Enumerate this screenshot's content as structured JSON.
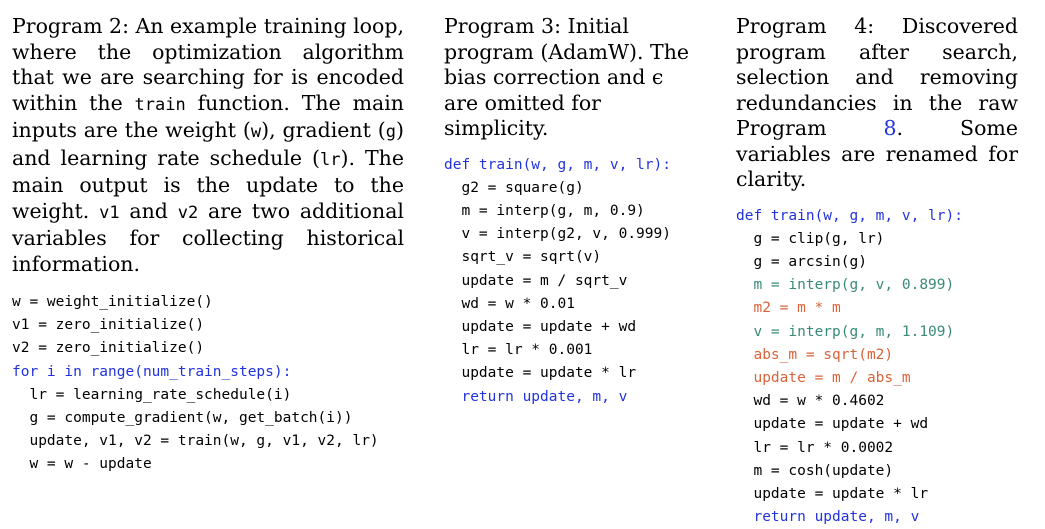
{
  "program2": {
    "caption": {
      "part1": "Program 2:",
      "part2": " An example training loop, where the optimization algorithm that we are searching for is encoded within the ",
      "code1": "train",
      "part3": " function. The main inputs are the weight (",
      "code2": "w",
      "part4": "), gradient (",
      "code3": "g",
      "part5": ") and learning rate schedule (",
      "code4": "lr",
      "part6": "). The main output is the update to the weight. ",
      "code5": "v1",
      "part7": " and ",
      "code6": "v2",
      "part8": " are two additional variables for collecting historical information."
    },
    "lines": [
      "w = weight_initialize()",
      "v1 = zero_initialize()",
      "v2 = zero_initialize()",
      "for i in range(num_train_steps):",
      "  lr = learning_rate_schedule(i)",
      "  g = compute_gradient(w, get_batch(i))",
      "  update, v1, v2 = train(w, g, v1, v2, lr)",
      "  w = w - update"
    ]
  },
  "program3": {
    "caption": {
      "part1": "Program 3:",
      "part2": " Initial program (AdamW). The bias correction and ",
      "epsilon": "ϵ",
      "part3": " are omitted for simplicity."
    },
    "lines": [
      "def train(w, g, m, v, lr):",
      "  g2 = square(g)",
      "  m = interp(g, m, 0.9)",
      "  v = interp(g2, v, 0.999)",
      "  sqrt_v = sqrt(v)",
      "  update = m / sqrt_v",
      "  wd = w * 0.01",
      "  update = update + wd",
      "  lr = lr * 0.001",
      "  update = update * lr",
      "  return update, m, v"
    ]
  },
  "program4": {
    "caption": {
      "part1": "Program 4:",
      "part2": " Discovered program after search, selection and removing redundancies in the raw Program ",
      "ref": "8",
      "part3": ". Some variables are renamed for clarity."
    },
    "lines": [
      "def train(w, g, m, v, lr):",
      "  g = clip(g, lr)",
      "  g = arcsin(g)",
      "  m = interp(g, v, 0.899)",
      "  m2 = m * m",
      "  v = interp(g, m, 1.109)",
      "  abs_m = sqrt(m2)",
      "  update = m / abs_m",
      "  wd = w * 0.4602",
      "  update = update + wd",
      "  lr = lr * 0.0002",
      "  m = cosh(update)",
      "  update = update * lr",
      "  return update, m, v"
    ]
  },
  "colors": {
    "keyword": "#2233dd",
    "highlight_teal": "#3a8a78",
    "highlight_orange": "#d9633a"
  }
}
